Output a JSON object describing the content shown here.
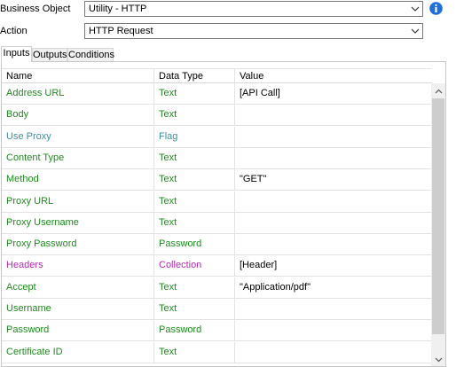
{
  "form": {
    "business_object_label": "Business Object",
    "business_object_value": "Utility - HTTP",
    "action_label": "Action",
    "action_value": "HTTP Request"
  },
  "icons": {
    "info": "info-icon",
    "dropdown": "chevron-down-icon",
    "scroll_up": "chevron-up-icon",
    "scroll_down": "chevron-down-icon"
  },
  "tabs": [
    {
      "label": "Inputs",
      "active": true
    },
    {
      "label": "Outputs",
      "active": false
    },
    {
      "label": "Conditions",
      "active": false
    }
  ],
  "grid": {
    "columns": [
      "Name",
      "Data Type",
      "Value"
    ],
    "rows": [
      {
        "name": "Address URL",
        "type": "Text",
        "value": "[API Call]",
        "color": "green"
      },
      {
        "name": "Body",
        "type": "Text",
        "value": "",
        "color": "green"
      },
      {
        "name": "Use Proxy",
        "type": "Flag",
        "value": "",
        "color": "teal"
      },
      {
        "name": "Content Type",
        "type": "Text",
        "value": "",
        "color": "green"
      },
      {
        "name": "Method",
        "type": "Text",
        "value": "\"GET\"",
        "color": "green"
      },
      {
        "name": "Proxy URL",
        "type": "Text",
        "value": "",
        "color": "green"
      },
      {
        "name": "Proxy Username",
        "type": "Text",
        "value": "",
        "color": "green"
      },
      {
        "name": "Proxy Password",
        "type": "Password",
        "value": "",
        "color": "green"
      },
      {
        "name": "Headers",
        "type": "Collection",
        "value": "[Header]",
        "color": "magenta"
      },
      {
        "name": "Accept",
        "type": "Text",
        "value": "\"Application/pdf\"",
        "color": "green"
      },
      {
        "name": "Username",
        "type": "Text",
        "value": "",
        "color": "green"
      },
      {
        "name": "Password",
        "type": "Password",
        "value": "",
        "color": "green"
      },
      {
        "name": "Certificate ID",
        "type": "Text",
        "value": "",
        "color": "green"
      }
    ]
  },
  "colors": {
    "text_type": "#1f8c1f",
    "flag_type": "#3b8fa6",
    "collection_type": "#b32db3",
    "info_icon": "#1e6fd9"
  }
}
